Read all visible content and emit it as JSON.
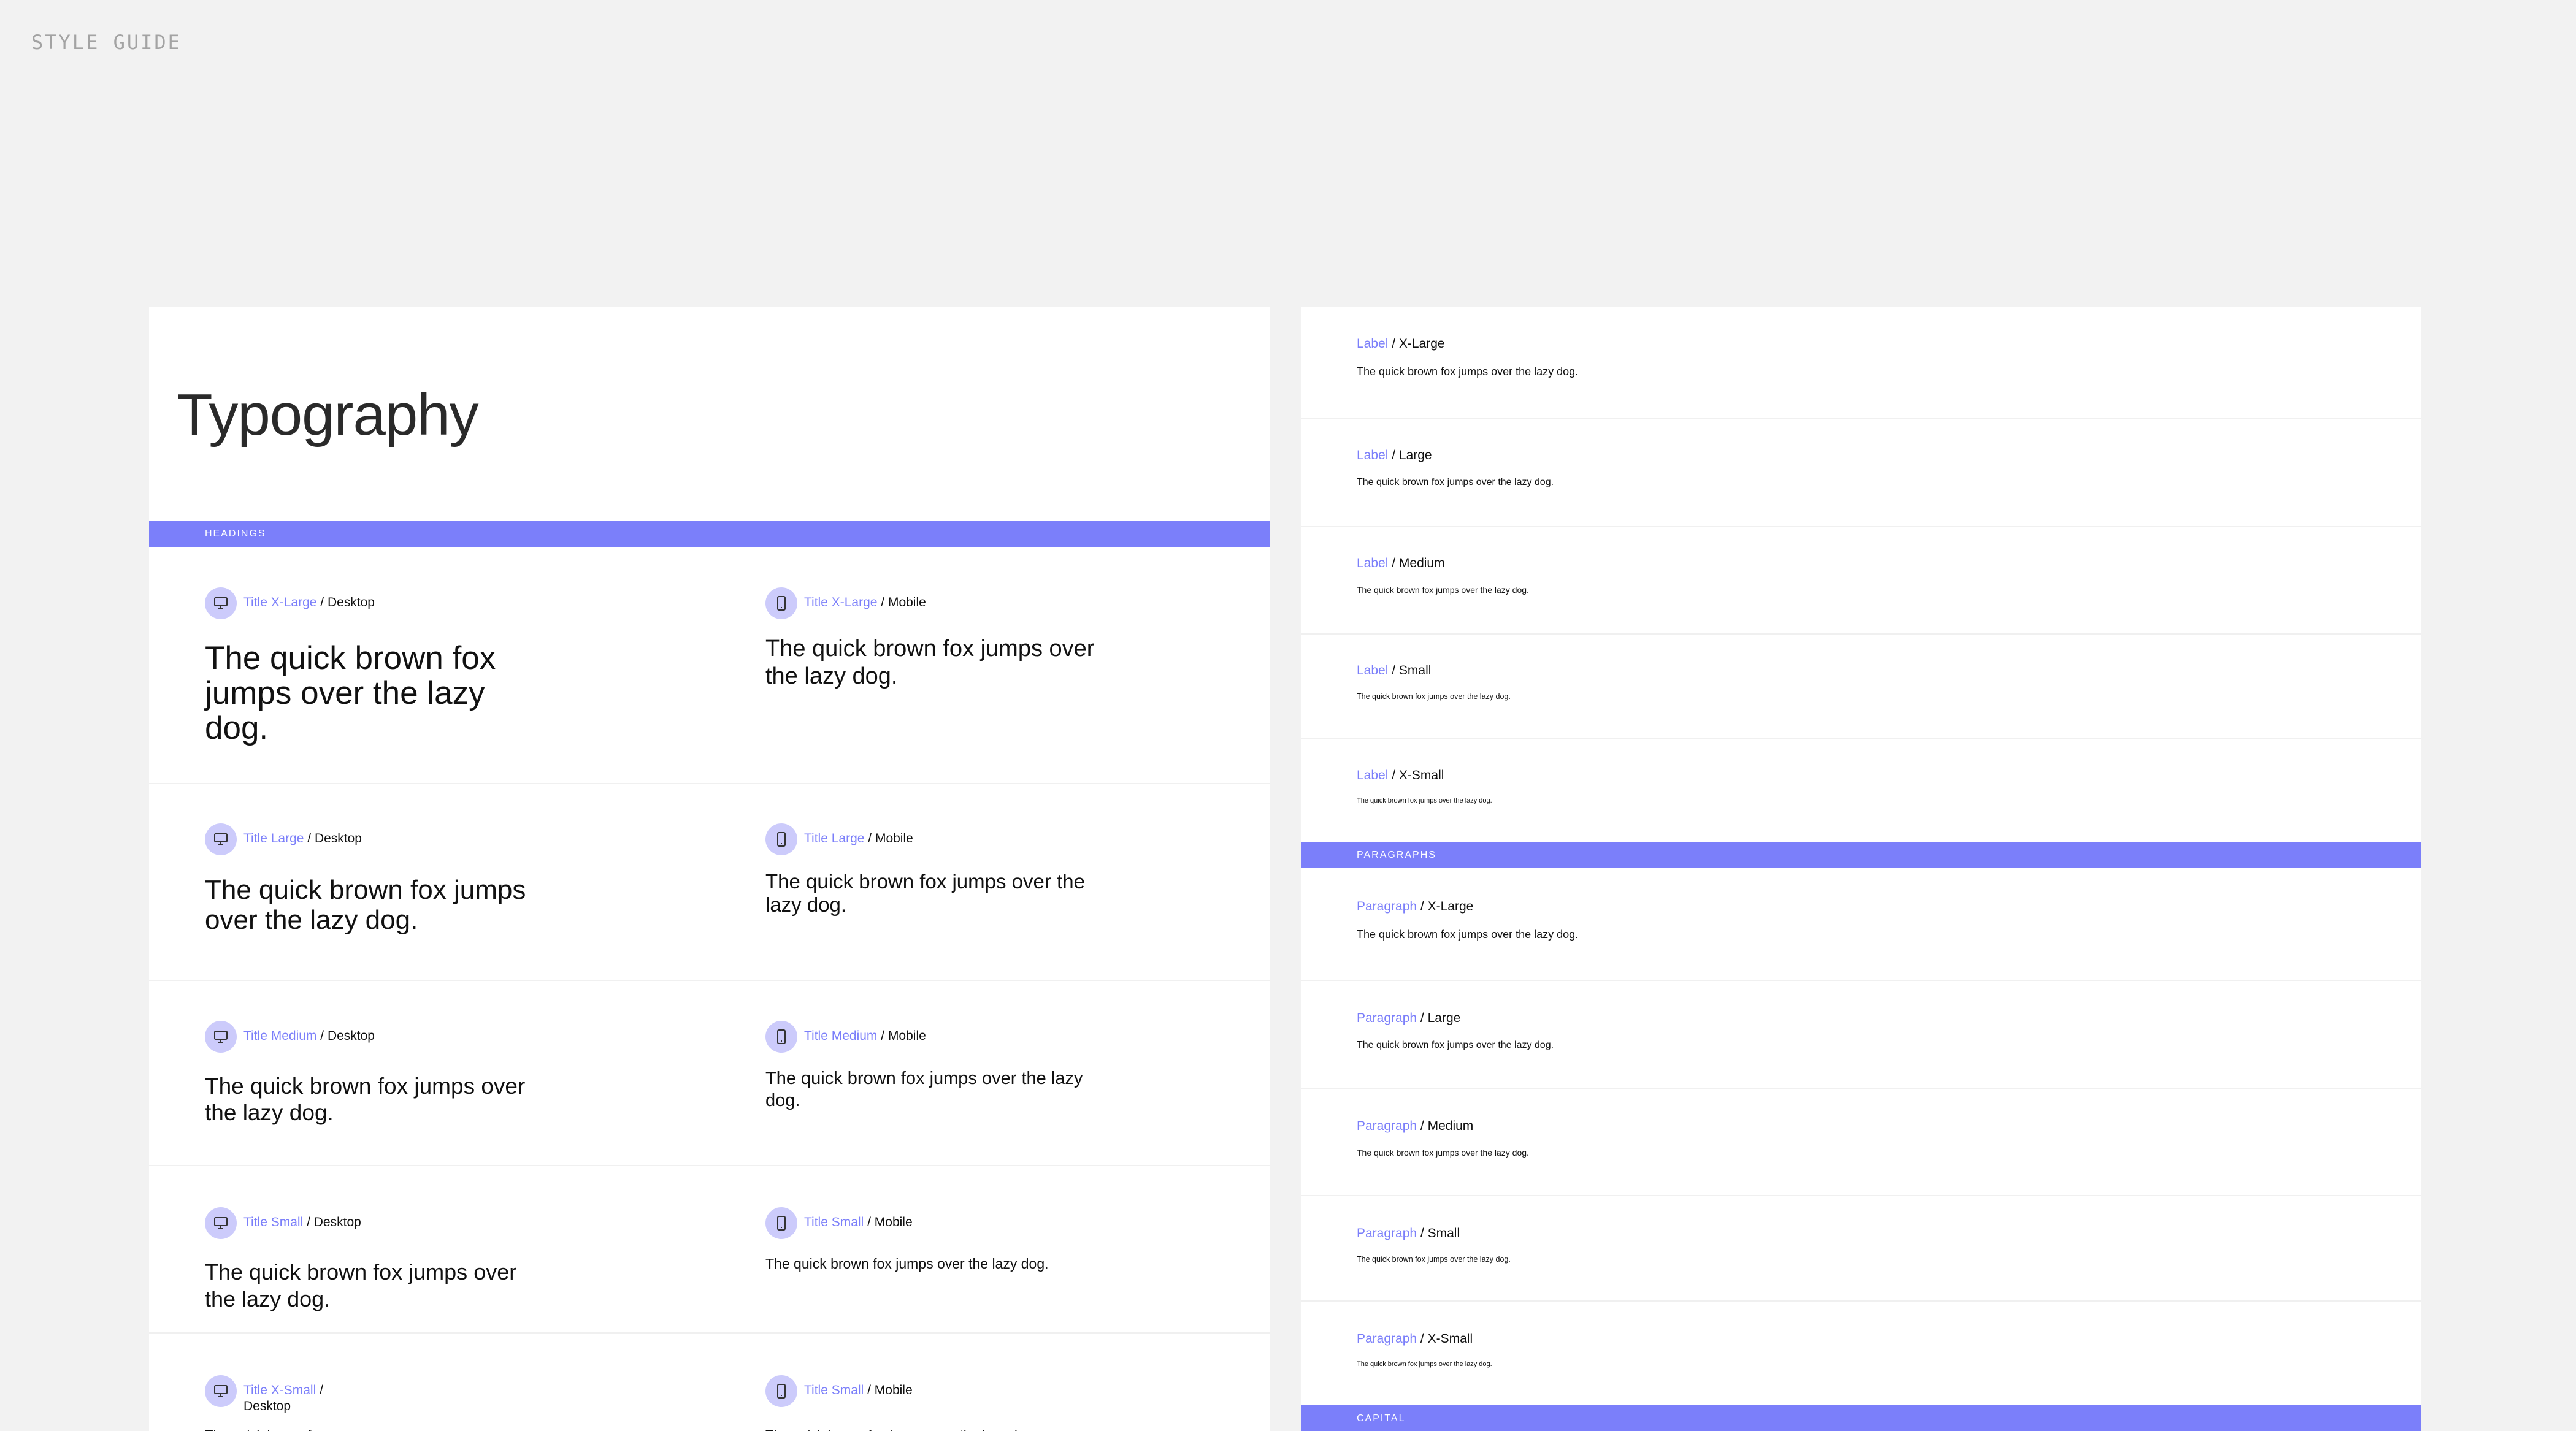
{
  "page_label": "STYLE GUIDE",
  "title": "Typography",
  "sections": {
    "headings": "HEADINGS",
    "paragraphs": "PARAGRAPHS",
    "capital": "CAPITAL"
  },
  "sample_text": "The quick brown fox jumps over the lazy dog.",
  "headings": [
    {
      "style": "Title X-Large",
      "desktop": "Desktop",
      "mobile": "Mobile"
    },
    {
      "style": "Title Large",
      "desktop": "Desktop",
      "mobile": "Mobile"
    },
    {
      "style": "Title Medium",
      "desktop": "Desktop",
      "mobile": "Mobile"
    },
    {
      "style": "Title Small",
      "desktop": "Desktop",
      "mobile": "Mobile"
    },
    {
      "style": "Title X-Small",
      "desktop": "Desktop",
      "mobile_style": "Title Small",
      "mobile": "Mobile"
    }
  ],
  "labels": [
    {
      "group": "Label",
      "size": "X-Large"
    },
    {
      "group": "Label",
      "size": "Large"
    },
    {
      "group": "Label",
      "size": "Medium"
    },
    {
      "group": "Label",
      "size": "Small"
    },
    {
      "group": "Label",
      "size": "X-Small"
    }
  ],
  "paragraphs": [
    {
      "group": "Paragraph",
      "size": "X-Large"
    },
    {
      "group": "Paragraph",
      "size": "Large"
    },
    {
      "group": "Paragraph",
      "size": "Medium"
    },
    {
      "group": "Paragraph",
      "size": "Small"
    },
    {
      "group": "Paragraph",
      "size": "X-Small"
    }
  ],
  "icons": {
    "desktop": "monitor-icon",
    "mobile": "phone-icon"
  },
  "colors": {
    "accent": "#7b7ffa",
    "icon_bg": "#cccbfb",
    "background": "#f2f2f2"
  }
}
